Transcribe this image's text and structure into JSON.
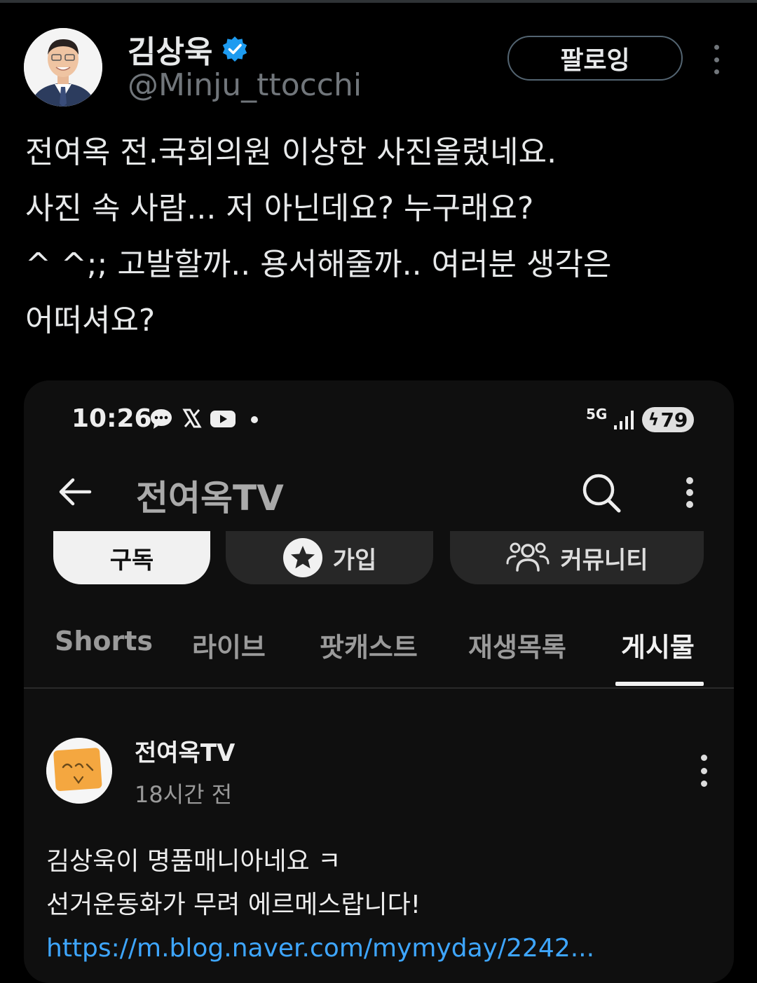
{
  "tweet": {
    "display_name": "김상욱",
    "handle": "@Minju_ttocchi",
    "follow_label": "팔로잉",
    "text_lines": [
      "전여옥 전.국회의원 이상한 사진올렸네요.",
      "사진 속 사람... 저 아닌데요? 누구래요?",
      "^ ^;; 고발할까.. 용서해줄까..  여러분 생각은",
      "어떠셔요?"
    ]
  },
  "media": {
    "status_bar": {
      "time": "10:26",
      "network": "5G",
      "battery": "79",
      "icons": [
        "chat-bubble-icon",
        "x-logo-icon",
        "youtube-icon",
        "dot-icon",
        "signal-icon"
      ]
    },
    "channel_title": "전여옥TV",
    "buttons": {
      "subscribe": "구독",
      "join": "가입",
      "community": "커뮤니티"
    },
    "tabs": [
      "Shorts",
      "라이브",
      "팟캐스트",
      "재생목록",
      "게시물"
    ],
    "active_tab": "게시물",
    "post": {
      "channel_name": "전여옥TV",
      "time_ago": "18시간 전",
      "lines": [
        "김상욱이 명품매니아네요 ㅋ",
        "선거운동화가 무려 에르메스랍니다!"
      ],
      "link": "https://m.blog.naver.com/mymyday/2242..."
    }
  },
  "colors": {
    "background": "#000000",
    "verified": "#1d9bf0",
    "link": "#3ea6ff",
    "secondary_text": "#71767b"
  }
}
